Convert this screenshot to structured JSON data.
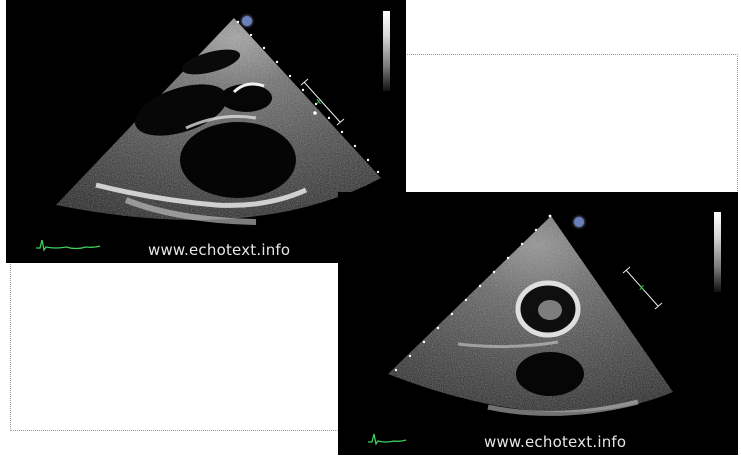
{
  "panels": [
    {
      "id": "parasternal-long-axis-view",
      "watermark": "www.echotext.info"
    },
    {
      "id": "parasternal-short-axis-view",
      "watermark": "www.echotext.info"
    }
  ],
  "colors": {
    "ultrasound_background": "#000000",
    "ecg_trace": "#3fcf5a",
    "depth_marker_dots": "#ffffff",
    "orientation_marker": "#6a7fb8"
  },
  "icons": [
    "orientation-marker-icon",
    "grey-scale-bar-icon",
    "ecg-trace-icon",
    "depth-scale-icon"
  ]
}
